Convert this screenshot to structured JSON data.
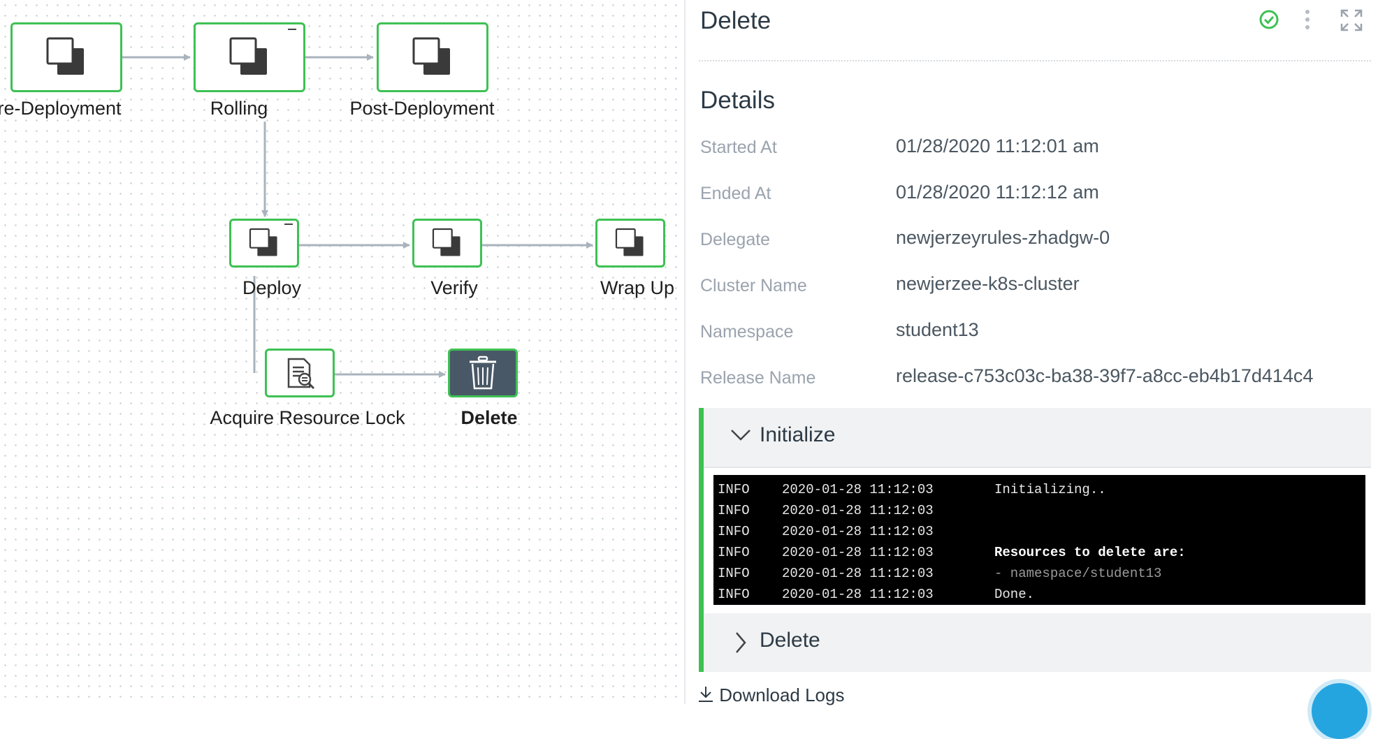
{
  "pipeline": {
    "nodes": [
      {
        "id": "pre-deployment",
        "label": "re-Deployment",
        "icon": "phase-icon"
      },
      {
        "id": "rolling",
        "label": "Rolling",
        "icon": "phase-icon"
      },
      {
        "id": "post-deployment",
        "label": "Post-Deployment",
        "icon": "phase-icon"
      },
      {
        "id": "deploy",
        "label": "Deploy",
        "icon": "phase-icon"
      },
      {
        "id": "verify",
        "label": "Verify",
        "icon": "phase-icon"
      },
      {
        "id": "wrap-up",
        "label": "Wrap Up",
        "icon": "phase-icon"
      },
      {
        "id": "acquire-resource-lock",
        "label": "Acquire Resource Lock",
        "icon": "resource-lock-icon"
      },
      {
        "id": "delete",
        "label": "Delete",
        "icon": "trash-icon",
        "selected": true
      }
    ],
    "status_color": "#3ec153",
    "selected_color": "#495867"
  },
  "panel": {
    "title": "Delete",
    "status_icon": "check-circle-icon",
    "menu_icon": "kebab-menu-icon",
    "expand_icon": "expand-icon",
    "details_title": "Details",
    "details": [
      {
        "label": "Started At",
        "value": "01/28/2020 11:12:01 am"
      },
      {
        "label": "Ended At",
        "value": "01/28/2020 11:12:12 am"
      },
      {
        "label": "Delegate",
        "value": "newjerzeyrules-zhadgw-0"
      },
      {
        "label": "Cluster Name",
        "value": "newjerzee-k8s-cluster"
      },
      {
        "label": "Namespace",
        "value": "student13"
      },
      {
        "label": "Release Name",
        "value": "release-c753c03c-ba38-39f7-a8cc-eb4b17d414c4"
      }
    ],
    "sections": [
      {
        "title": "Initialize",
        "expanded": true
      },
      {
        "title": "Delete",
        "expanded": false
      }
    ],
    "logs": [
      {
        "level": "INFO",
        "time": "2020-01-28 11:12:03",
        "message": "Initializing..",
        "style": "normal"
      },
      {
        "level": "INFO",
        "time": "2020-01-28 11:12:03",
        "message": "",
        "style": "normal"
      },
      {
        "level": "INFO",
        "time": "2020-01-28 11:12:03",
        "message": "",
        "style": "normal"
      },
      {
        "level": "INFO",
        "time": "2020-01-28 11:12:03",
        "message": "Resources to delete are:",
        "style": "bold"
      },
      {
        "level": "INFO",
        "time": "2020-01-28 11:12:03",
        "message": "- namespace/student13",
        "style": "dim"
      },
      {
        "level": "INFO",
        "time": "2020-01-28 11:12:03",
        "message": "Done.",
        "style": "normal"
      }
    ],
    "download_label": "Download Logs",
    "download_icon": "download-icon",
    "accent_color": "#3ec153"
  }
}
